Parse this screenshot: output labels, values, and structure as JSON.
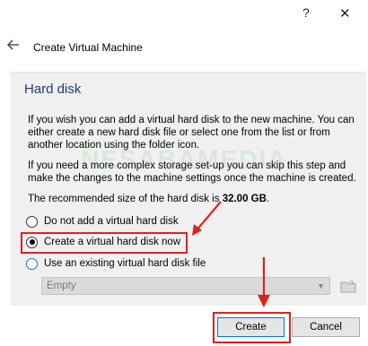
{
  "window": {
    "help_glyph": "?",
    "close_glyph": "✕"
  },
  "header": {
    "title": "Create Virtual Machine"
  },
  "section": {
    "title": "Hard disk"
  },
  "text": {
    "p1": "If you wish you can add a virtual hard disk to the new machine. You can either create a new hard disk file or select one from the list or from another location using the folder icon.",
    "p2": "If you need a more complex storage set-up you can skip this step and make the changes to the machine settings once the machine is created.",
    "p3_prefix": "The recommended size of the hard disk is ",
    "p3_size": "32.00 GB",
    "p3_suffix": "."
  },
  "options": [
    {
      "label": "Do not add a virtual hard disk",
      "selected": false
    },
    {
      "label": "Create a virtual hard disk now",
      "selected": true
    },
    {
      "label": "Use an existing virtual hard disk file",
      "selected": false
    }
  ],
  "disk_select": {
    "value": "Empty"
  },
  "buttons": {
    "create": "Create",
    "cancel": "Cancel"
  },
  "watermark": "NESABAMEDIA",
  "colors": {
    "section_title": "#1e3c6e",
    "highlight": "#e02020",
    "accent": "#0078d7"
  }
}
